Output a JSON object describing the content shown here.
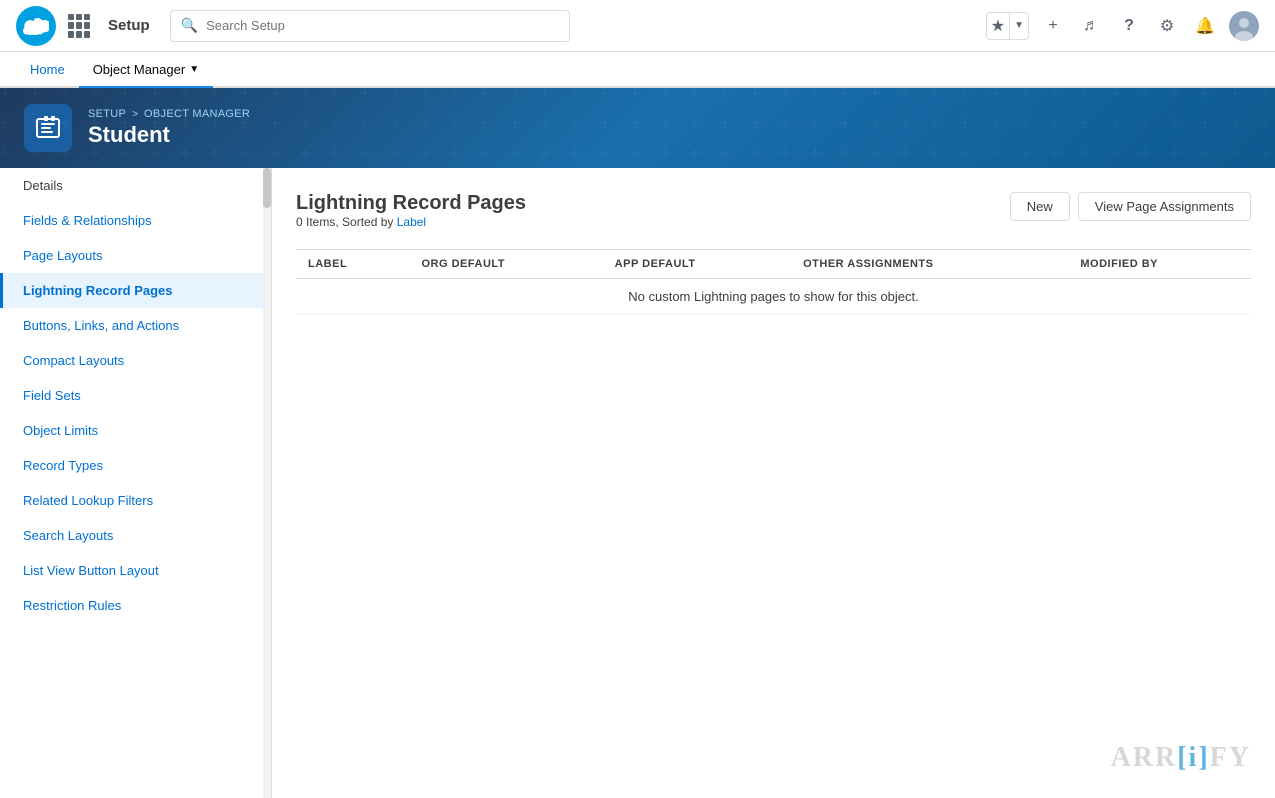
{
  "topNav": {
    "searchPlaceholder": "Search Setup",
    "setupLabel": "Setup",
    "homeTab": "Home",
    "objectManagerTab": "Object Manager"
  },
  "breadcrumb": {
    "setup": "SETUP",
    "objectManager": "OBJECT MANAGER",
    "separator": ">"
  },
  "header": {
    "title": "Student"
  },
  "sidebar": {
    "items": [
      {
        "label": "Details",
        "active": false
      },
      {
        "label": "Fields & Relationships",
        "active": false
      },
      {
        "label": "Page Layouts",
        "active": false
      },
      {
        "label": "Lightning Record Pages",
        "active": true
      },
      {
        "label": "Buttons, Links, and Actions",
        "active": false
      },
      {
        "label": "Compact Layouts",
        "active": false
      },
      {
        "label": "Field Sets",
        "active": false
      },
      {
        "label": "Object Limits",
        "active": false
      },
      {
        "label": "Record Types",
        "active": false
      },
      {
        "label": "Related Lookup Filters",
        "active": false
      },
      {
        "label": "Search Layouts",
        "active": false
      },
      {
        "label": "List View Button Layout",
        "active": false
      },
      {
        "label": "Restriction Rules",
        "active": false
      }
    ]
  },
  "content": {
    "title": "Lightning Record Pages",
    "subtitle": "0 Items, Sorted by",
    "sortedByLink": "Label",
    "newButton": "New",
    "viewPageAssignmentsButton": "View Page Assignments",
    "emptyMessage": "No custom Lightning pages to show for this object.",
    "table": {
      "columns": [
        "Label",
        "Org Default",
        "App Default",
        "Other Assignments",
        "Modified By"
      ],
      "columnKeys": [
        "LABEL",
        "ORG DEFAULT",
        "APP DEFAULT",
        "OTHER ASSIGNMENTS",
        "MODIFIED BY"
      ]
    }
  },
  "watermark": {
    "text": "ARR[i]FY",
    "parts": [
      "ARR",
      "i",
      "FY"
    ]
  }
}
